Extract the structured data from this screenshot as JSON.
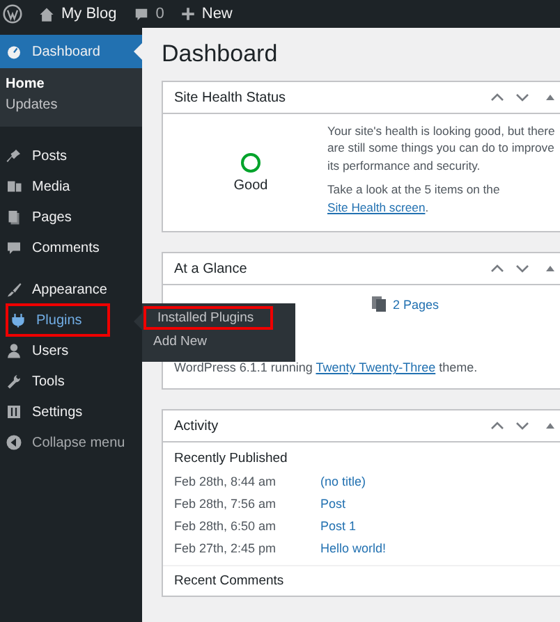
{
  "admin_bar": {
    "site_name": "My Blog",
    "comment_count": "0",
    "new_label": "New"
  },
  "sidebar": {
    "items": [
      {
        "label": "Dashboard",
        "selected": true,
        "hover": false,
        "highlighted": false,
        "submenu": [
          {
            "label": "Home",
            "selected": true
          },
          {
            "label": "Updates",
            "selected": false
          }
        ]
      },
      {
        "label": "Posts",
        "selected": false,
        "hover": false,
        "highlighted": false
      },
      {
        "label": "Media",
        "selected": false,
        "hover": false,
        "highlighted": false
      },
      {
        "label": "Pages",
        "selected": false,
        "hover": false,
        "highlighted": false
      },
      {
        "label": "Comments",
        "selected": false,
        "hover": false,
        "highlighted": false
      },
      {
        "label": "Appearance",
        "selected": false,
        "hover": false,
        "highlighted": false
      },
      {
        "label": "Plugins",
        "selected": false,
        "hover": true,
        "highlighted": true,
        "flyout": [
          {
            "label": "Installed Plugins",
            "highlighted": true
          },
          {
            "label": "Add New",
            "highlighted": false
          }
        ]
      },
      {
        "label": "Users",
        "selected": false,
        "hover": false,
        "highlighted": false
      },
      {
        "label": "Tools",
        "selected": false,
        "hover": false,
        "highlighted": false
      },
      {
        "label": "Settings",
        "selected": false,
        "hover": false,
        "highlighted": false
      }
    ],
    "collapse_label": "Collapse menu"
  },
  "page_title": "Dashboard",
  "site_health": {
    "title": "Site Health Status",
    "status": "Good",
    "message": "Your site's health is looking good, but there are still some things you can do to improve its performance and security.",
    "hint": "Take a look at the 5 items on the",
    "link": "Site Health screen",
    "hint_end": "."
  },
  "at_a_glance": {
    "title": "At a Glance",
    "pages": "2 Pages",
    "version_text": "WordPress 6.1.1 running",
    "theme_link": "Twenty Twenty-Three",
    "theme_end": "theme."
  },
  "activity": {
    "title": "Activity",
    "recently_published": "Recently Published",
    "rows": [
      {
        "date": "Feb 28th, 8:44 am",
        "title": "(no title)"
      },
      {
        "date": "Feb 28th, 7:56 am",
        "title": "Post"
      },
      {
        "date": "Feb 28th, 6:50 am",
        "title": "Post 1"
      },
      {
        "date": "Feb 27th, 2:45 pm",
        "title": "Hello world!"
      }
    ],
    "recent_comments": "Recent Comments"
  }
}
